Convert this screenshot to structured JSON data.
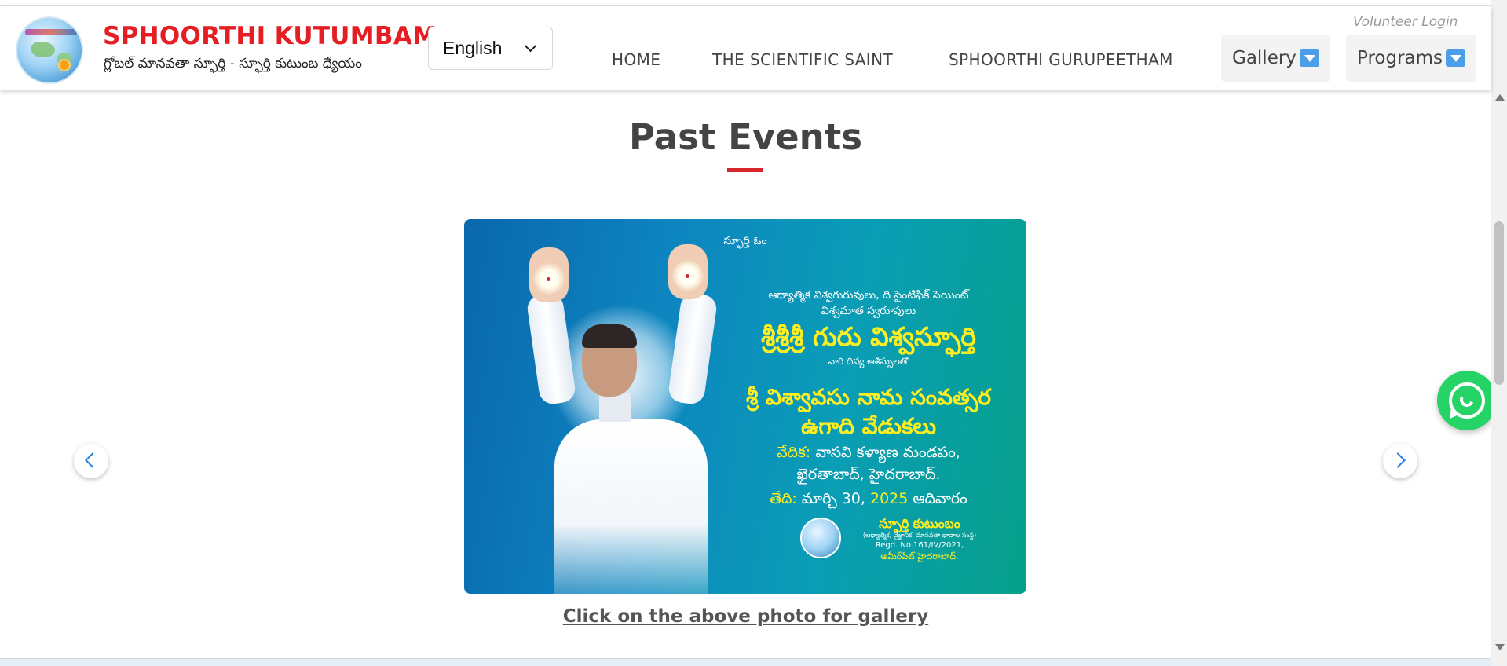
{
  "header": {
    "brand": "SPHOORTHI KUTUMBAM",
    "tagline": "గ్లోబల్ మానవతా స్ఫూర్తి - స్ఫూర్తి కుటుంబ ధ్యేయం",
    "language": "English",
    "volunteer_login": "Volunteer Login",
    "nav": {
      "home": "HOME",
      "scientific_saint": "THE SCIENTIFIC SAINT",
      "gurupeetham": "SPHOORTHI GURUPEETHAM",
      "gallery": "Gallery",
      "programs": "Programs"
    }
  },
  "section": {
    "title": "Past Events",
    "caption": "Click on the above photo for gallery"
  },
  "slide": {
    "top": "స్ఫూర్తి ఓం",
    "line1": "ఆధ్యాత్మిక విశ్వగురువులు, ది సైంటిఫిక్ సెయింట్",
    "line2": "విశ్వమాత స్వరూపులు",
    "name": "శ్రీశ్రీశ్రీ గురు విశ్వస్ఫూర్తి",
    "blessing": "వారి దివ్య ఆశీస్సులతో",
    "event1": "శ్రీ విశ్వావసు నామ సంవత్సర",
    "event2": "ఉగాది వేడుకలు",
    "venue_label": "వేదిక:",
    "venue1": "వాసవి కళ్యాణ మండపం,",
    "venue2": "ఖైరతాబాద్, హైదరాబాద్.",
    "date_label": "తేది:",
    "date_pre": "మార్చి 30,",
    "date_year": "2025",
    "date_day": "ఆదివారం",
    "org_name": "స్ఫూర్తి కుటుంబం",
    "org_sub": "(ఆధ్యాత్మిక, వైజ్ఞానిక, మానవతా భావాల సంస్థ)",
    "org_reg": "Regd. No.161/IV/2021,",
    "org_place": "అమీర్‌పేట్ హైదరాబాద్."
  },
  "colors": {
    "brand": "#e41e23",
    "accent_bar": "#d8262e",
    "whatsapp": "#25d366",
    "carousel_arrow": "#1d7fe0"
  }
}
